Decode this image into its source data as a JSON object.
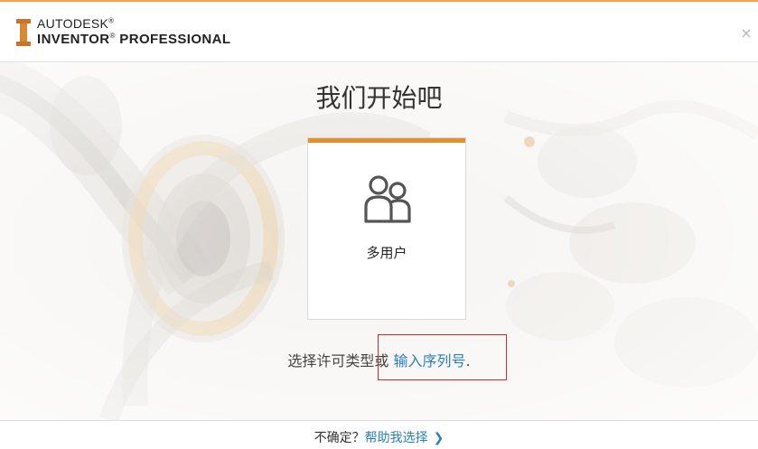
{
  "header": {
    "brand_top": "AUTODESK",
    "brand_mark": "®",
    "brand_bottom": "INVENTOR",
    "brand_bottom_mark": "®",
    "brand_bottom_suffix": " PROFESSIONAL",
    "close_icon": "close-icon",
    "close_glyph": "×"
  },
  "main": {
    "title": "我们开始吧",
    "card": {
      "label": "多用户",
      "icon": "multi-user-icon",
      "accent_color": "#e0912c"
    },
    "license_prefix": "选择许可类型或 ",
    "license_link": "输入序列号",
    "license_suffix": "."
  },
  "footer": {
    "prefix": "不确定？",
    "help_link": "帮助我选择",
    "chevron": "❯"
  },
  "colors": {
    "link": "#2b7fc1",
    "accent": "#e0912c",
    "highlight": "#d62a2a"
  }
}
